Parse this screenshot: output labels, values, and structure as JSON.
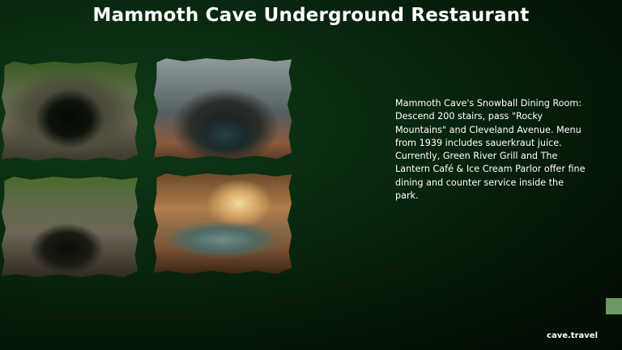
{
  "title": "Mammoth Cave Underground Restaurant",
  "description": "Mammoth Cave's Snowball Dining Room: Descend 200 stairs, pass \"Rocky Mountains\" and Cleveland Avenue. Menu from 1939 includes sauerkraut juice. Currently, Green River Grill and The Lantern Café & Ice Cream Parlor offer fine dining and counter service inside the park.",
  "footer": "cave.travel",
  "colors": {
    "background": "#0a2a10",
    "title_text": "#ffffff",
    "corner_block": "#6a9a62"
  },
  "images": [
    {
      "name": "cave-sinkhole-photo"
    },
    {
      "name": "cave-entrance-arch-photo"
    },
    {
      "name": "cave-gorge-photo"
    },
    {
      "name": "lit-cave-lake-photo"
    }
  ]
}
